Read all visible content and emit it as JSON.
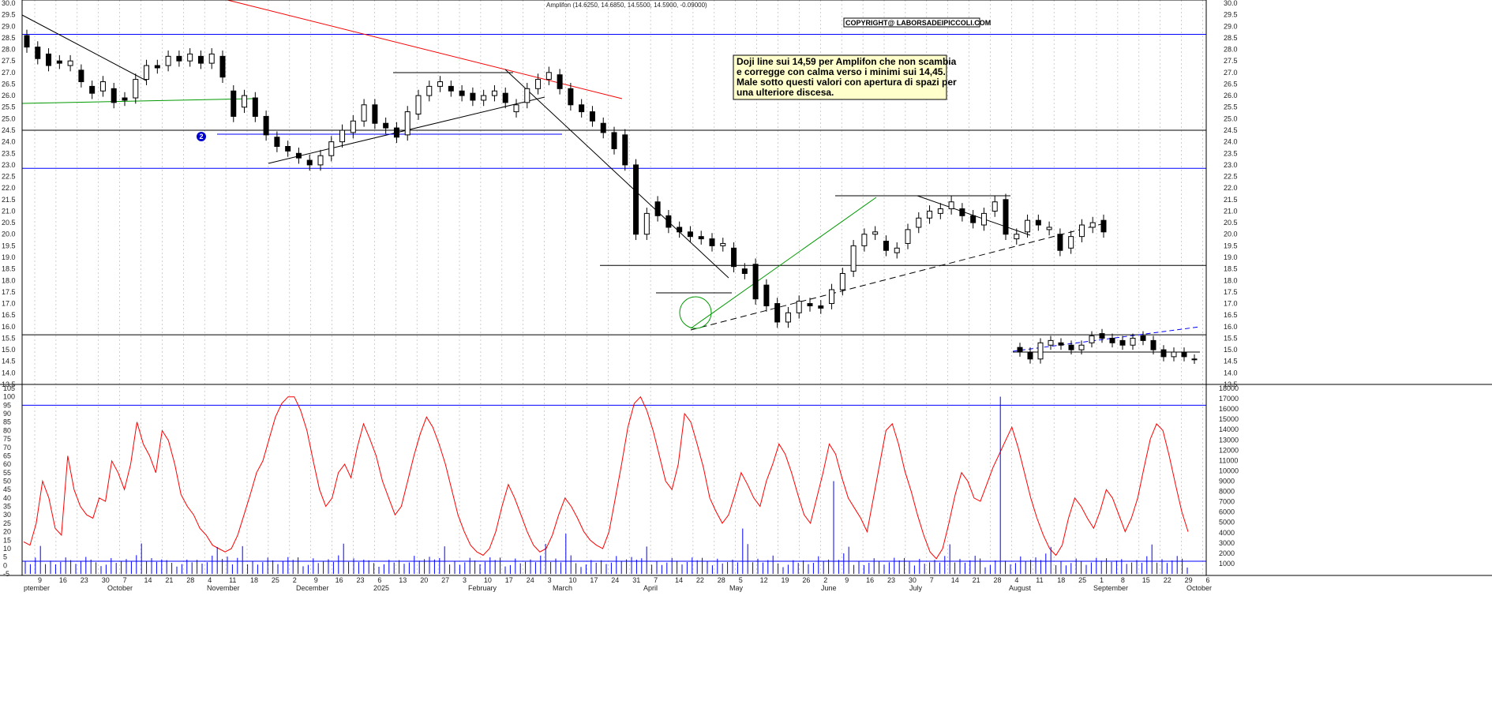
{
  "header": {
    "ticker_line": "Amplifon (14.6250, 14.6850, 14.5500, 14.5900, -0.09000)",
    "copyright": "COPYRIGHT@ LABORSADEIPICCOLI.COM"
  },
  "annotation": {
    "lines": [
      "Doji line sui 14,59 per Amplifon che non scambia",
      "e corregge con calma verso i minimi sui 14,45.",
      "Male sotto questi valori con apertura di spazi per",
      "una ulteriore discesa."
    ],
    "marker": "2"
  },
  "colors": {
    "candle_up": "#ffffff",
    "candle_down": "#000000",
    "support_lines": "#0000ff",
    "resistance_trend": "#ff0000",
    "oscillator": "#ff0000",
    "volume": "#0000ff",
    "green_trend": "#009900"
  },
  "chart_data": [
    {
      "type": "candlestick",
      "title": "Amplifon",
      "ylim": [
        13.5,
        30.0
      ],
      "yticks": [
        "30.0",
        "29.5",
        "29.0",
        "28.5",
        "28.0",
        "27.5",
        "27.0",
        "26.5",
        "26.0",
        "25.5",
        "25.0",
        "24.5",
        "24.0",
        "23.5",
        "23.0",
        "22.5",
        "22.0",
        "21.5",
        "21.0",
        "20.5",
        "20.0",
        "19.5",
        "19.0",
        "18.5",
        "18.0",
        "17.5",
        "17.0",
        "16.5",
        "16.0",
        "15.5",
        "15.0",
        "14.5",
        "14.0",
        "13.5"
      ],
      "horizontal_levels": [
        28.65,
        24.5,
        22.85,
        18.65,
        15.65
      ],
      "x_day_labels": [
        "9",
        "16",
        "23",
        "30",
        "7",
        "14",
        "21",
        "28",
        "4",
        "11",
        "18",
        "25",
        "2",
        "9",
        "16",
        "23",
        "6",
        "13",
        "20",
        "27",
        "3",
        "10",
        "17",
        "24",
        "3",
        "10",
        "17",
        "24",
        "31",
        "7",
        "14",
        "22",
        "28",
        "5",
        "12",
        "19",
        "26",
        "2",
        "9",
        "16",
        "23",
        "30",
        "7",
        "14",
        "21",
        "28",
        "4",
        "11",
        "18",
        "25",
        "1",
        "8",
        "15",
        "22",
        "29",
        "6"
      ],
      "x_month_labels": [
        "ptember",
        "October",
        "November",
        "December",
        "2025",
        "February",
        "March",
        "April",
        "May",
        "June",
        "July",
        "August",
        "September",
        "October"
      ],
      "last_close": 14.59
    },
    {
      "type": "line",
      "series": [
        {
          "name": "",
          "values": [
            14,
            12,
            25,
            50,
            40,
            22,
            18,
            65,
            45,
            35,
            30,
            28,
            40,
            38,
            62,
            55,
            45,
            60,
            85,
            72,
            65,
            55,
            80,
            74,
            60,
            42,
            35,
            30,
            22,
            18,
            12,
            10,
            8,
            10,
            18,
            30,
            42,
            55,
            62,
            75,
            88,
            96,
            100,
            100,
            92,
            80,
            62,
            45,
            35,
            40,
            55,
            60,
            52,
            70,
            84,
            75,
            65,
            50,
            40,
            30,
            35,
            50,
            65,
            78,
            88,
            82,
            72,
            60,
            45,
            30,
            20,
            12,
            8,
            6,
            10,
            20,
            35,
            48,
            40,
            30,
            20,
            12,
            8,
            10,
            18,
            30,
            40,
            35,
            28,
            20,
            15,
            12,
            10,
            20,
            40,
            60,
            82,
            96,
            100,
            92,
            80,
            65,
            50,
            45,
            60,
            90,
            85,
            72,
            58,
            40,
            32,
            25,
            30,
            42,
            55,
            48,
            40,
            35,
            50,
            60,
            72,
            66,
            55,
            42,
            30,
            25,
            40,
            55,
            72,
            66,
            52,
            40,
            34,
            28,
            20,
            40,
            60,
            80,
            84,
            72,
            56,
            44,
            30,
            18,
            8,
            4,
            10,
            25,
            42,
            55,
            50,
            40,
            38,
            48,
            58,
            66,
            74,
            82,
            70,
            55,
            40,
            28,
            18,
            10,
            6,
            12,
            28,
            40,
            35,
            28,
            22,
            32,
            45,
            40,
            30,
            20,
            28,
            40,
            58,
            75,
            84,
            80,
            65,
            48,
            32,
            20
          ]
        }
      ],
      "ylim": [
        -5,
        105
      ],
      "yticks": [
        "105",
        "100",
        "95",
        "90",
        "85",
        "80",
        "75",
        "70",
        "65",
        "60",
        "55",
        "50",
        "45",
        "40",
        "35",
        "30",
        "25",
        "20",
        "15",
        "10",
        "5",
        "0",
        "-5"
      ],
      "horizontal_levels": [
        95,
        2.5
      ]
    },
    {
      "type": "bar",
      "series": [
        {
          "name": "",
          "values": []
        }
      ],
      "ylim": [
        0,
        18000
      ],
      "yticks": [
        "18000",
        "17000",
        "16000",
        "15000",
        "14000",
        "13000",
        "12000",
        "11000",
        "10000",
        "9000",
        "8000",
        "7000",
        "6000",
        "5000",
        "4000",
        "3000",
        "2000",
        "1000"
      ]
    }
  ]
}
